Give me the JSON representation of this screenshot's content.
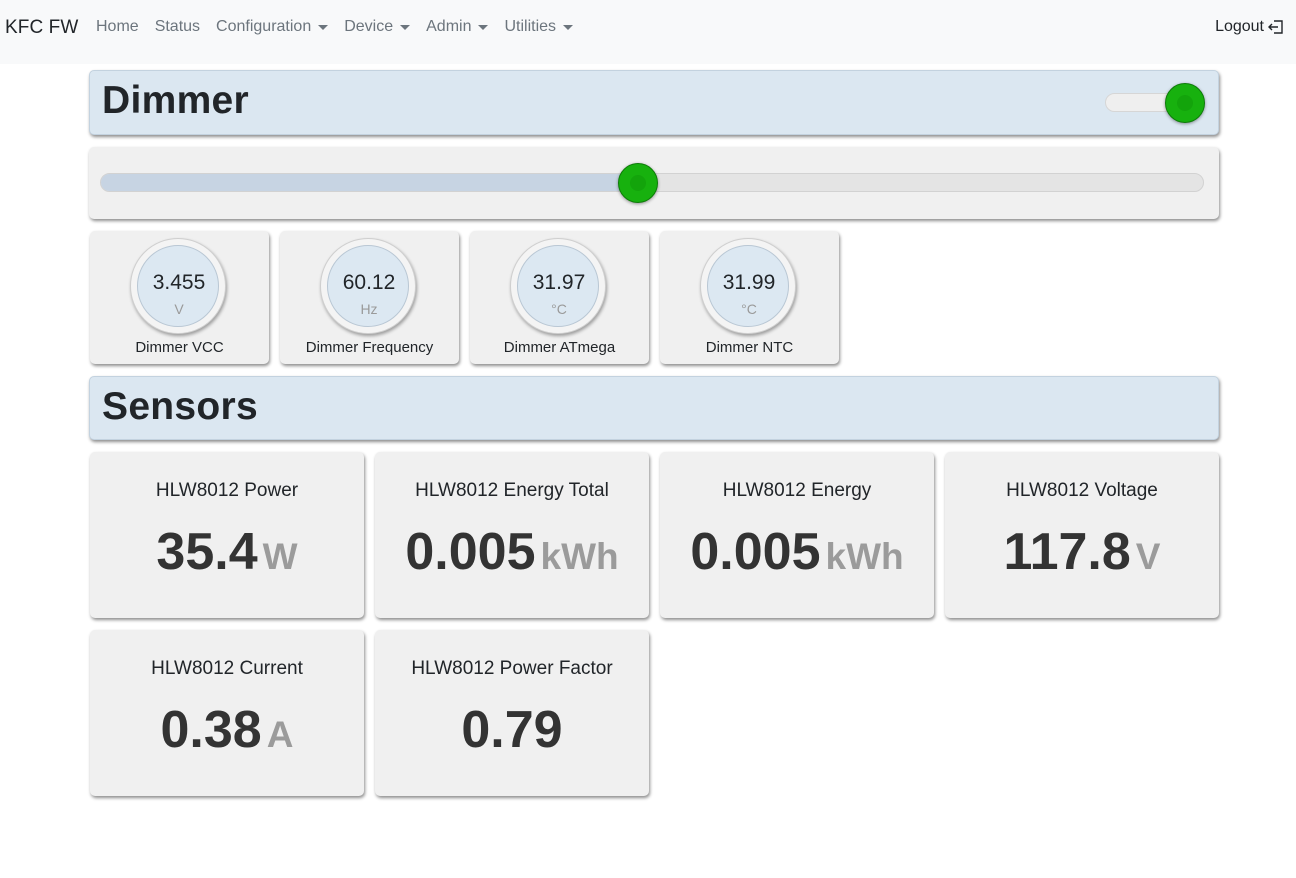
{
  "navbar": {
    "brand": "KFC FW",
    "items": [
      {
        "label": "Home",
        "dropdown": false
      },
      {
        "label": "Status",
        "dropdown": false
      },
      {
        "label": "Configuration",
        "dropdown": true
      },
      {
        "label": "Device",
        "dropdown": true
      },
      {
        "label": "Admin",
        "dropdown": true
      },
      {
        "label": "Utilities",
        "dropdown": true
      }
    ],
    "logout_label": "Logout",
    "logout_icon": "logout-icon"
  },
  "dimmer": {
    "title": "Dimmer",
    "toggle_on": true,
    "level_fraction": 0.487,
    "gauges": [
      {
        "value": "3.455",
        "unit": "V",
        "label": "Dimmer VCC"
      },
      {
        "value": "60.12",
        "unit": "Hz",
        "label": "Dimmer Frequency"
      },
      {
        "value": "31.97",
        "unit": "°C",
        "label": "Dimmer ATmega"
      },
      {
        "value": "31.99",
        "unit": "°C",
        "label": "Dimmer NTC"
      }
    ]
  },
  "sensors": {
    "title": "Sensors",
    "cards": [
      {
        "title": "HLW8012 Power",
        "value": "35.4",
        "unit": "W"
      },
      {
        "title": "HLW8012 Energy Total",
        "value": "0.005",
        "unit": "kWh"
      },
      {
        "title": "HLW8012 Energy",
        "value": "0.005",
        "unit": "kWh"
      },
      {
        "title": "HLW8012 Voltage",
        "value": "117.8",
        "unit": "V"
      },
      {
        "title": "HLW8012 Current",
        "value": "0.38",
        "unit": "A"
      },
      {
        "title": "HLW8012 Power Factor",
        "value": "0.79",
        "unit": ""
      }
    ]
  },
  "colors": {
    "accent_green": "#17b10e",
    "header_blue": "#dbe7f1",
    "panel_gray": "#f0f0f0"
  }
}
